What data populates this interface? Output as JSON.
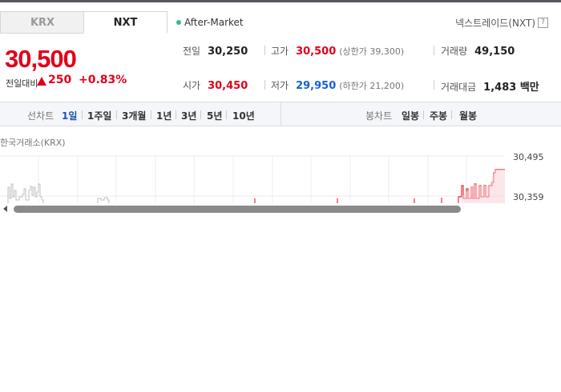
{
  "tabs": [
    {
      "label": "KRX",
      "active": false
    },
    {
      "label": "NXT",
      "active": true
    }
  ],
  "session": {
    "label": "After-Market",
    "dot_color": "#2fbf8c"
  },
  "provider": {
    "label": "넥스트레이드(NXT)",
    "help_glyph": "?"
  },
  "price": {
    "current": "30,500",
    "change_label": "전일대비",
    "change_amount": "250",
    "change_percent": "+0.83%",
    "direction": "up",
    "up_color": "#e0021a",
    "down_color": "#1460d6"
  },
  "stats": {
    "prev_close": {
      "label": "전일",
      "value": "30,250"
    },
    "high": {
      "label": "고가",
      "value": "30,500",
      "sub": "(상한가 39,300)"
    },
    "volume": {
      "label": "거래량",
      "value": "49,150"
    },
    "open": {
      "label": "시가",
      "value": "30,450"
    },
    "low": {
      "label": "저가",
      "value": "29,950",
      "sub": "(하한가 21,200)"
    },
    "trade_value": {
      "label": "거래대금",
      "value": "1,483 백만"
    }
  },
  "line_periods": {
    "title": "선차트",
    "items": [
      "1일",
      "1주일",
      "3개월",
      "1년",
      "3년",
      "5년",
      "10년"
    ],
    "active": "1일"
  },
  "candle_periods": {
    "title": "봉차트",
    "items": [
      "일봉",
      "주봉",
      "월봉"
    ]
  },
  "chart": {
    "source_label": "한국거래소(KRX)",
    "y_labels": [
      "30,495",
      "30,359"
    ]
  }
}
